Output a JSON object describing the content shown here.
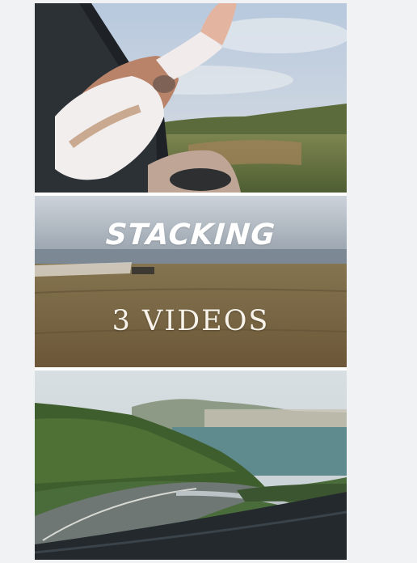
{
  "thumbnail": {
    "title": "STACKING",
    "subtitle": "3 VIDEOS",
    "panels": [
      {
        "scene": "hand-out-car-window"
      },
      {
        "scene": "open-field"
      },
      {
        "scene": "coastal-road"
      }
    ]
  },
  "colors": {
    "page_background": "#f1f2f4",
    "title_text": "#ffffff",
    "subtitle_text": "#f7f3ea"
  }
}
